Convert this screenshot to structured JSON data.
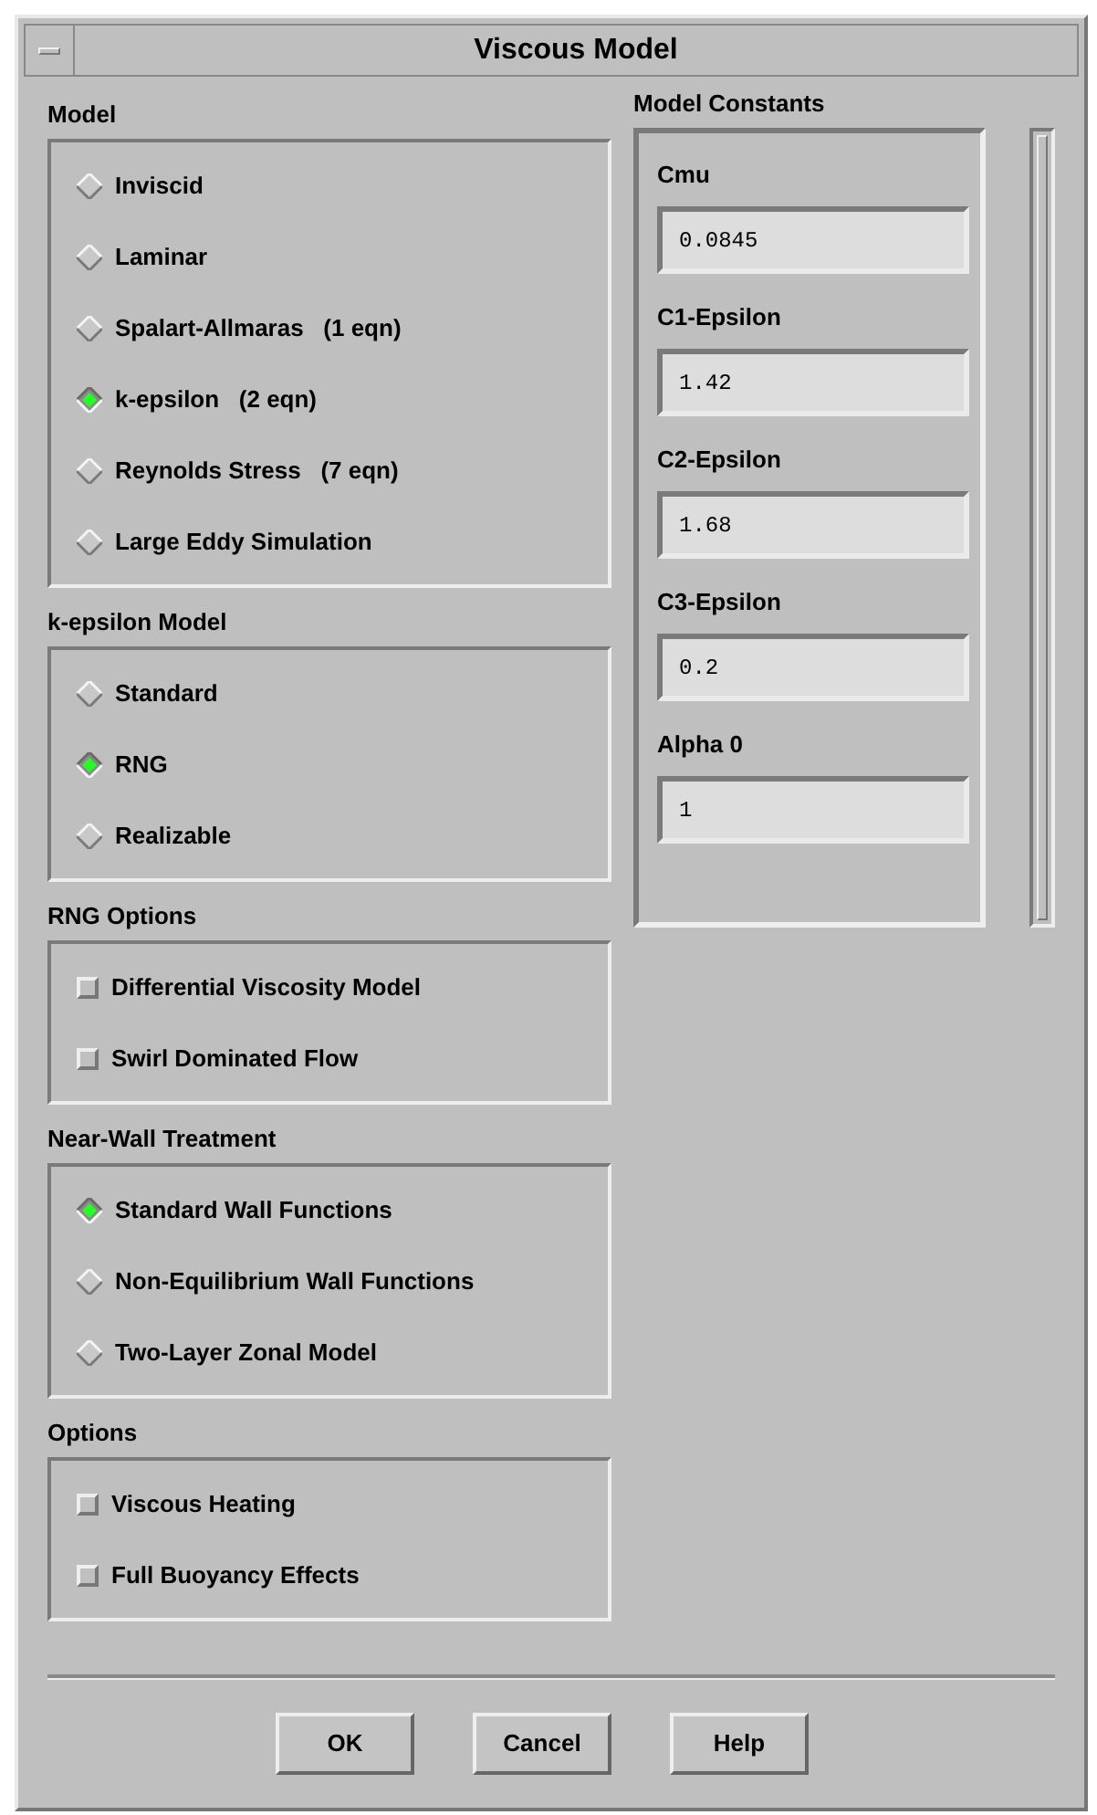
{
  "window": {
    "title": "Viscous Model"
  },
  "sections": [
    {
      "kind": "radio",
      "title": "Model",
      "options": [
        {
          "label": "Inviscid",
          "selected": false
        },
        {
          "label": "Laminar",
          "selected": false
        },
        {
          "label": "Spalart-Allmaras   (1 eqn)",
          "selected": false
        },
        {
          "label": "k-epsilon   (2 eqn)",
          "selected": true
        },
        {
          "label": "Reynolds Stress   (7 eqn)",
          "selected": false
        },
        {
          "label": "Large Eddy Simulation",
          "selected": false
        }
      ]
    },
    {
      "kind": "radio",
      "title": "k-epsilon Model",
      "options": [
        {
          "label": "Standard",
          "selected": false
        },
        {
          "label": "RNG",
          "selected": true
        },
        {
          "label": "Realizable",
          "selected": false
        }
      ]
    },
    {
      "kind": "check",
      "title": "RNG Options",
      "options": [
        {
          "label": "Differential Viscosity Model",
          "checked": false
        },
        {
          "label": "Swirl Dominated Flow",
          "checked": false
        }
      ]
    },
    {
      "kind": "radio",
      "title": "Near-Wall Treatment",
      "options": [
        {
          "label": "Standard Wall Functions",
          "selected": true
        },
        {
          "label": "Non-Equilibrium Wall Functions",
          "selected": false
        },
        {
          "label": "Two-Layer Zonal Model",
          "selected": false
        }
      ]
    },
    {
      "kind": "check",
      "title": "Options",
      "options": [
        {
          "label": "Viscous Heating",
          "checked": false
        },
        {
          "label": "Full Buoyancy Effects",
          "checked": false
        }
      ]
    }
  ],
  "constants": {
    "title": "Model Constants",
    "fields": [
      {
        "label": "Cmu",
        "value": "0.0845"
      },
      {
        "label": "C1-Epsilon",
        "value": "1.42"
      },
      {
        "label": "C2-Epsilon",
        "value": "1.68"
      },
      {
        "label": "C3-Epsilon",
        "value": "0.2"
      },
      {
        "label": "Alpha 0",
        "value": "1"
      }
    ]
  },
  "buttons": [
    "OK",
    "Cancel",
    "Help"
  ]
}
